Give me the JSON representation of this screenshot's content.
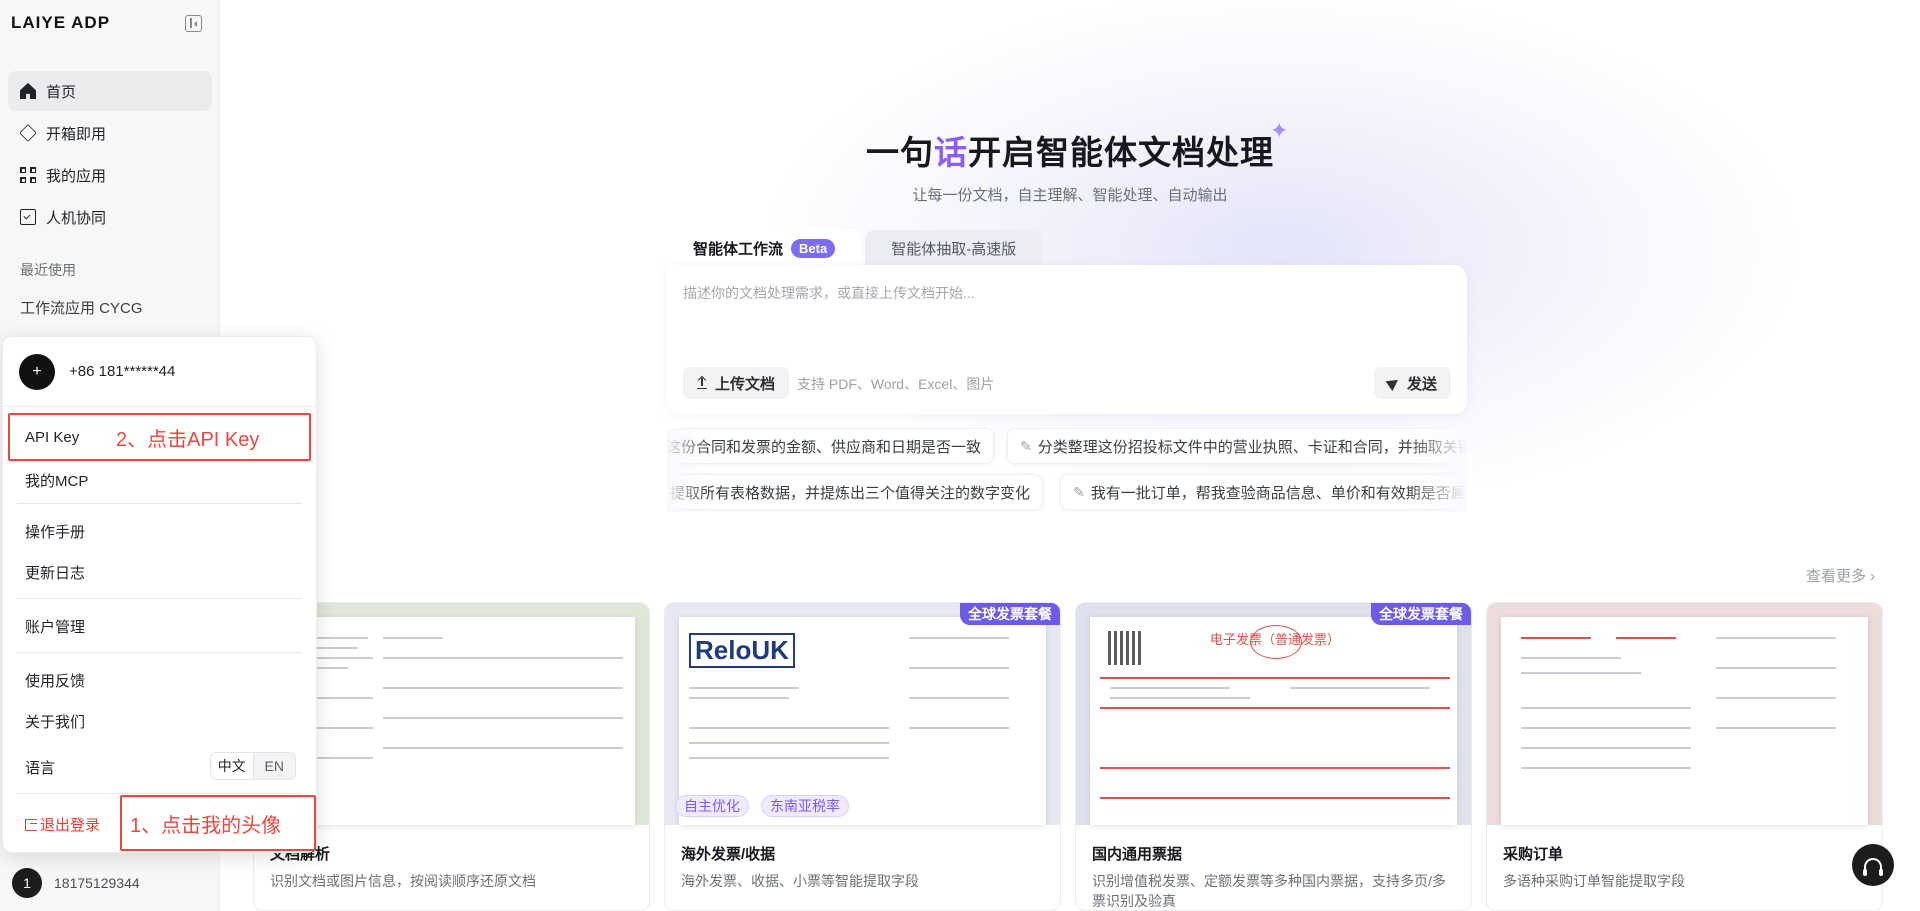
{
  "sidebar": {
    "logo": "LAIYE ADP",
    "nav": [
      {
        "label": "首页",
        "icon": "home-icon",
        "active": true
      },
      {
        "label": "开箱即用",
        "icon": "box-icon",
        "active": false
      },
      {
        "label": "我的应用",
        "icon": "apps-grid-icon",
        "active": false
      },
      {
        "label": "人机协同",
        "icon": "clipboard-check-icon",
        "active": false
      }
    ],
    "recent_title": "最近使用",
    "recent_items": [
      "工作流应用 CYCG"
    ],
    "user": {
      "avatar_text": "1",
      "phone": "18175129344"
    }
  },
  "popup": {
    "avatar_text": "+",
    "phone": "+86 181******44",
    "items": {
      "api_key": "API Key",
      "my_mcp": "我的MCP",
      "manual": "操作手册",
      "changelog": "更新日志",
      "account": "账户管理",
      "feedback": "使用反馈",
      "about": "关于我们",
      "language": "语言",
      "logout": "退出登录"
    },
    "lang_options": [
      "中文",
      "EN"
    ],
    "lang_selected": "中文"
  },
  "annotations": {
    "step1": "1、点击我的头像",
    "step2": "2、点击API Key",
    "color": "#e8483f"
  },
  "hero": {
    "title_part1": "一句",
    "title_accent": "话",
    "title_part2": "开启智能体文档处理",
    "accent_color": "#8b5cf6",
    "subtitle": "让每一份文档，自主理解、智能处理、自动输出"
  },
  "tabs": [
    {
      "label": "智能体工作流",
      "badge": "Beta",
      "active": true
    },
    {
      "label": "智能体抽取-高速版",
      "active": false
    }
  ],
  "prompt": {
    "placeholder": "描述你的文档处理需求，或直接上传文档开始...",
    "upload_label": "上传文档",
    "upload_hint": "支持 PDF、Word、Excel、图片",
    "send_label": "发送"
  },
  "chips": {
    "row1": [
      "这份合同和发票的金额、供应商和日期是否一致",
      "分类整理这份招投标文件中的营业执照、卡证和合同，并抽取关键"
    ],
    "row2": [
      "提取所有表格数据，并提炼出三个值得关注的数字变化",
      "我有一批订单，帮我查验商品信息、单价和有效期是否属"
    ]
  },
  "see_more": "查看更多 ›",
  "cards": [
    {
      "title": "文档解析",
      "desc": "识别文档或图片信息，按阅读顺序还原文档",
      "badge": "",
      "tags": [],
      "bg": "#dfe7d8"
    },
    {
      "title": "海外发票/收据",
      "desc": "海外发票、收据、小票等智能提取字段",
      "badge": "全球发票套餐",
      "tags": [
        "自主优化",
        "东南亚税率"
      ],
      "bg": "#e6e8f2",
      "doc_logo": "ReloUK"
    },
    {
      "title": "国内通用票据",
      "desc": "识别增值税发票、定额发票等多种国内票据，支持多页/多票识别及验真",
      "badge": "全球发票套餐",
      "tags": [],
      "bg": "#dfe1ec",
      "doc_heading": "电子发票（普通发票）"
    },
    {
      "title": "采购订单",
      "desc": "多语种采购订单智能提取字段",
      "badge": "",
      "tags": [],
      "bg": "#ecdcdc"
    }
  ]
}
